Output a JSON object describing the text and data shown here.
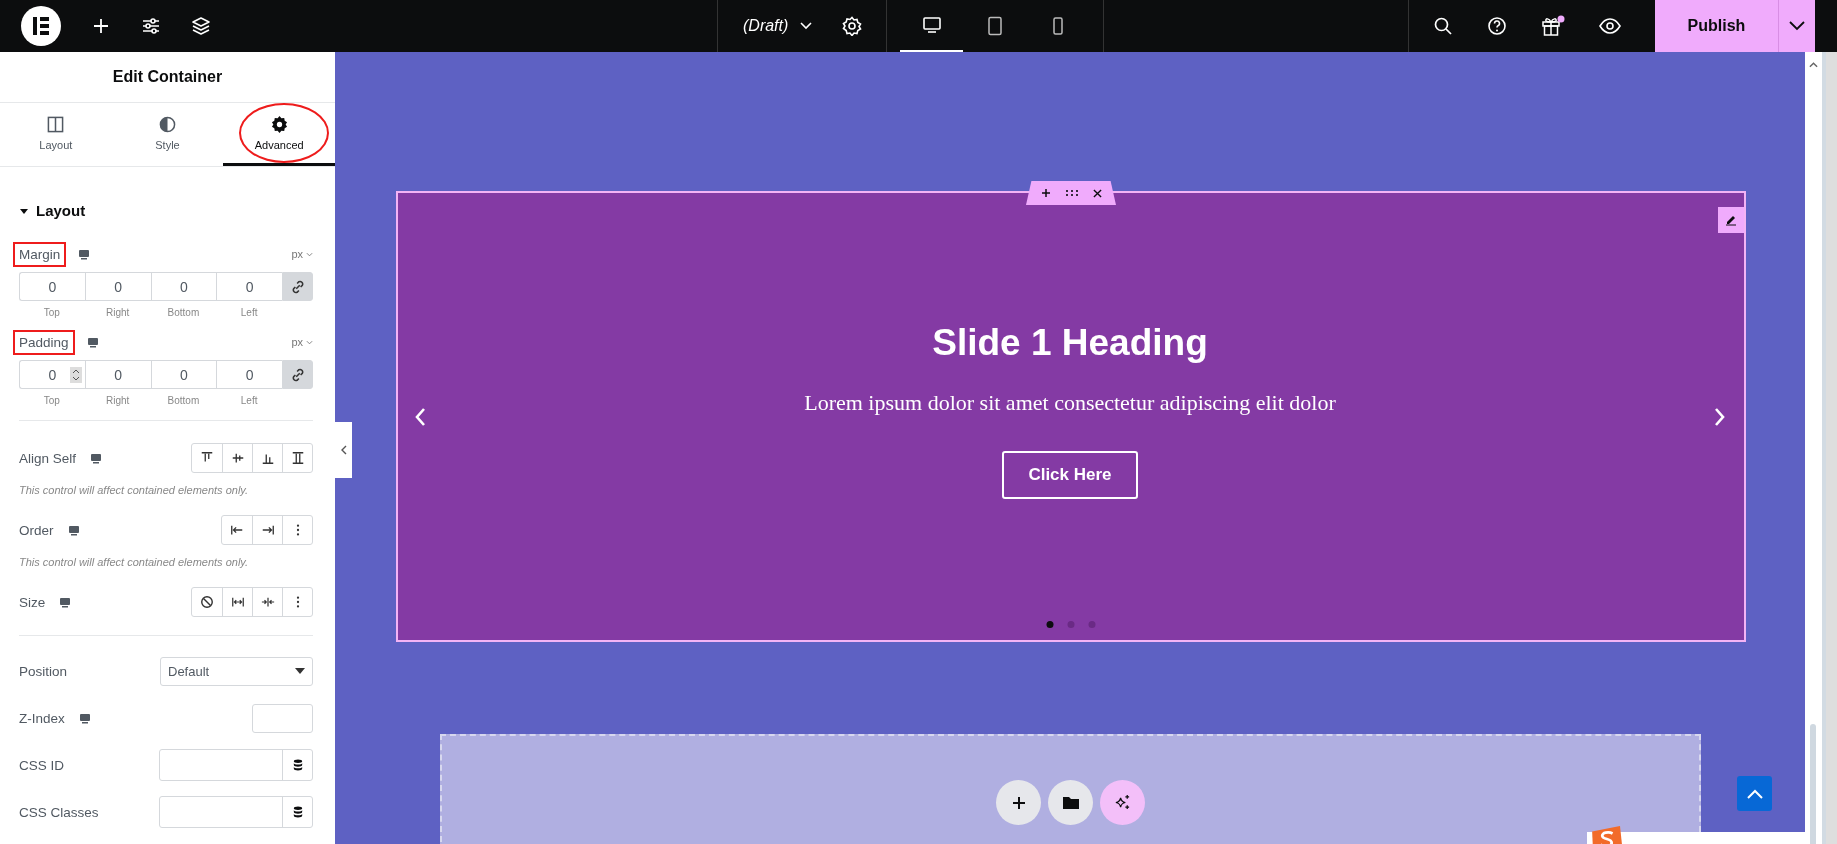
{
  "topbar": {
    "draft_label": "(Draft)",
    "devices": [
      {
        "kind": "desktop",
        "selected": true
      },
      {
        "kind": "tablet",
        "selected": false
      },
      {
        "kind": "mobile",
        "selected": false
      }
    ],
    "notification": true,
    "publish": "Publish"
  },
  "panel": {
    "title": "Edit Container",
    "tabs": [
      {
        "label": "Layout",
        "kind": "layout",
        "selected": false
      },
      {
        "label": "Style",
        "kind": "style",
        "selected": false
      },
      {
        "label": "Advanced",
        "kind": "advanced",
        "selected": true,
        "circled": true
      }
    ],
    "section": {
      "title": "Layout",
      "expanded": true
    },
    "spacing": [
      {
        "label": "Margin",
        "unit": "px",
        "highlighted": true,
        "linked": true,
        "fields": [
          {
            "value": "0",
            "label": "Top"
          },
          {
            "value": "0",
            "label": "Right"
          },
          {
            "value": "0",
            "label": "Bottom"
          },
          {
            "value": "0",
            "label": "Left"
          }
        ]
      },
      {
        "label": "Padding",
        "unit": "px",
        "highlighted": true,
        "linked": true,
        "fields": [
          {
            "value": "0",
            "label": "Top",
            "spinner": true
          },
          {
            "value": "0",
            "label": "Right"
          },
          {
            "value": "0",
            "label": "Bottom"
          },
          {
            "value": "0",
            "label": "Left"
          }
        ]
      }
    ],
    "choice_rows": [
      {
        "label": "Align Self",
        "buttons": [
          {
            "kind": "align-start"
          },
          {
            "kind": "align-center"
          },
          {
            "kind": "align-end"
          },
          {
            "kind": "align-stretch"
          }
        ],
        "note": "This control will affect contained elements only."
      },
      {
        "label": "Order",
        "buttons": [
          {
            "kind": "order-start"
          },
          {
            "kind": "order-end"
          },
          {
            "kind": "more"
          }
        ],
        "note": "This control will affect contained elements only."
      },
      {
        "label": "Size",
        "buttons": [
          {
            "kind": "none"
          },
          {
            "kind": "grow"
          },
          {
            "kind": "shrink"
          },
          {
            "kind": "more"
          }
        ]
      }
    ],
    "fields": [
      {
        "label": "Position",
        "kind": "select",
        "value": "Default"
      },
      {
        "label": "Z-Index",
        "kind": "number",
        "responsive": true
      },
      {
        "label": "CSS ID",
        "kind": "dynamic"
      },
      {
        "label": "CSS Classes",
        "kind": "dynamic"
      }
    ]
  },
  "canvas": {
    "slide": {
      "heading": "Slide 1 Heading",
      "text": "Lorem ipsum dolor sit amet consectetur adipiscing elit dolor",
      "button": "Click Here",
      "dots": [
        {
          "selected": true
        },
        {
          "selected": false
        },
        {
          "selected": false
        }
      ]
    }
  }
}
